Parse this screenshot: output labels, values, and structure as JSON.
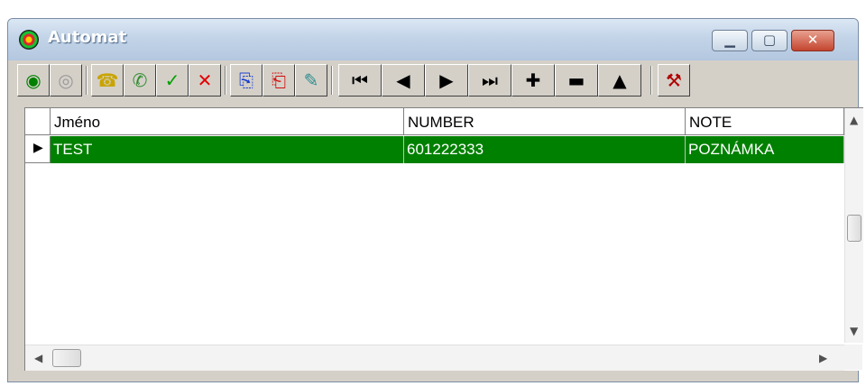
{
  "window": {
    "title": "Automat"
  },
  "toolbar": {
    "buttons": [
      {
        "name": "start-icon",
        "glyph": "◉",
        "color": "#008000"
      },
      {
        "name": "stop-icon",
        "glyph": "◎",
        "color": "#9a9a9a"
      },
      {
        "name": "phone-icon",
        "glyph": "☎",
        "color": "#c9a400"
      },
      {
        "name": "handset-icon",
        "glyph": "✆",
        "color": "#2e8b2e"
      },
      {
        "name": "check-icon",
        "glyph": "✓",
        "color": "#00a000"
      },
      {
        "name": "delete-icon",
        "glyph": "✕",
        "color": "#e00000"
      },
      {
        "name": "export-icon",
        "glyph": "⎘",
        "color": "#1b3fd1"
      },
      {
        "name": "import-icon",
        "glyph": "⎗",
        "color": "#d01010"
      },
      {
        "name": "edit-icon",
        "glyph": "✎",
        "color": "#2c8c8c"
      },
      {
        "name": "first-record-icon",
        "glyph": "⏮",
        "color": "#000000"
      },
      {
        "name": "prior-record-icon",
        "glyph": "◀",
        "color": "#000000"
      },
      {
        "name": "next-record-icon",
        "glyph": "▶",
        "color": "#000000"
      },
      {
        "name": "last-record-icon",
        "glyph": "⏭",
        "color": "#000000"
      },
      {
        "name": "insert-record-icon",
        "glyph": "✚",
        "color": "#000000"
      },
      {
        "name": "delete-record-icon",
        "glyph": "▬",
        "color": "#000000"
      },
      {
        "name": "post-edit-icon",
        "glyph": "▲",
        "color": "#000000"
      },
      {
        "name": "settings-icon",
        "glyph": "⚒",
        "color": "#b00000"
      }
    ]
  },
  "grid": {
    "columns": [
      "Jméno",
      "NUMBER",
      "NOTE"
    ],
    "rows": [
      {
        "selected": true,
        "cells": [
          "TEST",
          "601222333",
          "POZNÁMKA"
        ]
      }
    ],
    "selection_color": "#008000"
  }
}
